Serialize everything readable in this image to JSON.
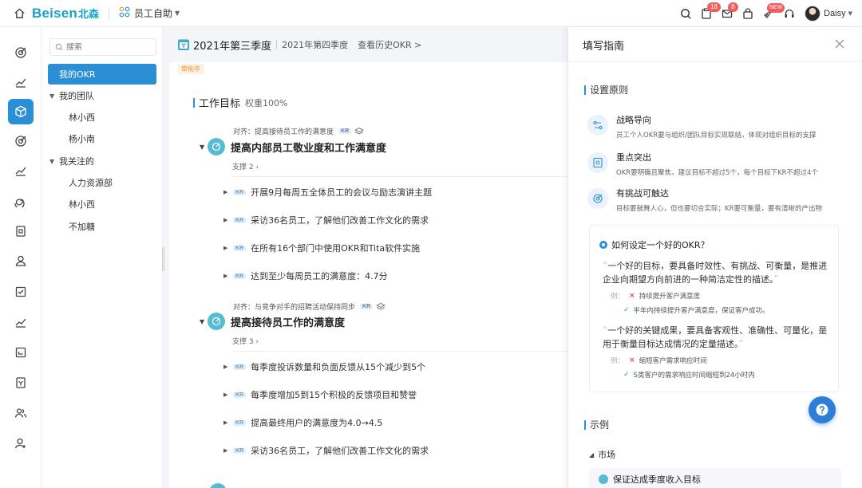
{
  "header": {
    "brand": "Beisen",
    "brand_cn": "北森",
    "app_name": "员工自助",
    "badges": {
      "notice": "18",
      "mail": "8",
      "new": "NEW"
    },
    "user_name": "Daisy"
  },
  "nav": {
    "search_placeholder": "搜索",
    "my_okr": "我的OKR",
    "my_team": "我的团队",
    "team_members": [
      "林小西",
      "杨小南"
    ],
    "followed": "我关注的",
    "followed_items": [
      "人力资源部",
      "林小西",
      "不加糖"
    ]
  },
  "main": {
    "current_quarter": "2021年第三季度",
    "next_quarter": "2021年第四季度",
    "history_link": "查看历史OKR >",
    "status": "审批中",
    "section_title": "工作目标",
    "weight": "权重100%",
    "objectives": [
      {
        "align": "对齐：提高接待员工作的满意度",
        "kr_tag": "KR",
        "title": "提高内部员工敬业度和工作满意度",
        "support": "支撑 2",
        "krs": [
          "开展9月每周五全体员工的会议与励志演讲主题",
          "采访36名员工，了解他们改善工作文化的需求",
          "在所有16个部门中使用OKR和Tita软件实施",
          "达到至少每周员工的满意度：4.7分"
        ]
      },
      {
        "align": "对齐：与竞争对手的招聘活动保持同步",
        "kr_tag": "KR",
        "title": "提高接待员工作的满意度",
        "support": "支撑 3",
        "krs": [
          "每季度投诉数量和负面反馈从15个减少到5个",
          "每季度增加5到15个积极的反馈项目和赞誉",
          "提高最终用户的满意度为4.0→4.5",
          "采访36名员工，了解他们改善工作文化的需求"
        ]
      }
    ]
  },
  "guide": {
    "title": "填写指南",
    "principles_title": "设置原则",
    "principles": [
      {
        "title": "战略导向",
        "desc": "员工个人OKR要与组织/团队目标实现联结，体现对组织目标的支撑"
      },
      {
        "title": "重点突出",
        "desc": "OKR要明确且聚焦，建议目标不超过5个，每个目标下KR不超过4个"
      },
      {
        "title": "有挑战可触达",
        "desc": "目标要鼓舞人心，但也要切合实际；KR要可衡量，要有清晰的产出物"
      }
    ],
    "howto_question": "如何设定一个好的OKR？",
    "quote1_line1": "一个好的目标，要具备时效性、有挑战、可衡量，是推进",
    "quote1_line2": "企业向期望方向前进的一种简洁定性的描述。",
    "ex_label": "例：",
    "ex1_bad": "持续提升客户满意度",
    "ex1_good": "半年内持续提升客户满意度，保证客户成功。",
    "quote2_line1": "一个好的关键成果，要具备客观性、准确性、可量化，是",
    "quote2_line2": "用于衡量目标达成情况的定量描述。",
    "ex2_bad": "缩短客户需求响应时间",
    "ex2_good": "S类客户的需求响应时间缩短到24小时内",
    "example_title": "示例",
    "market": "市场",
    "example_objective": "保证达成季度收入目标"
  }
}
